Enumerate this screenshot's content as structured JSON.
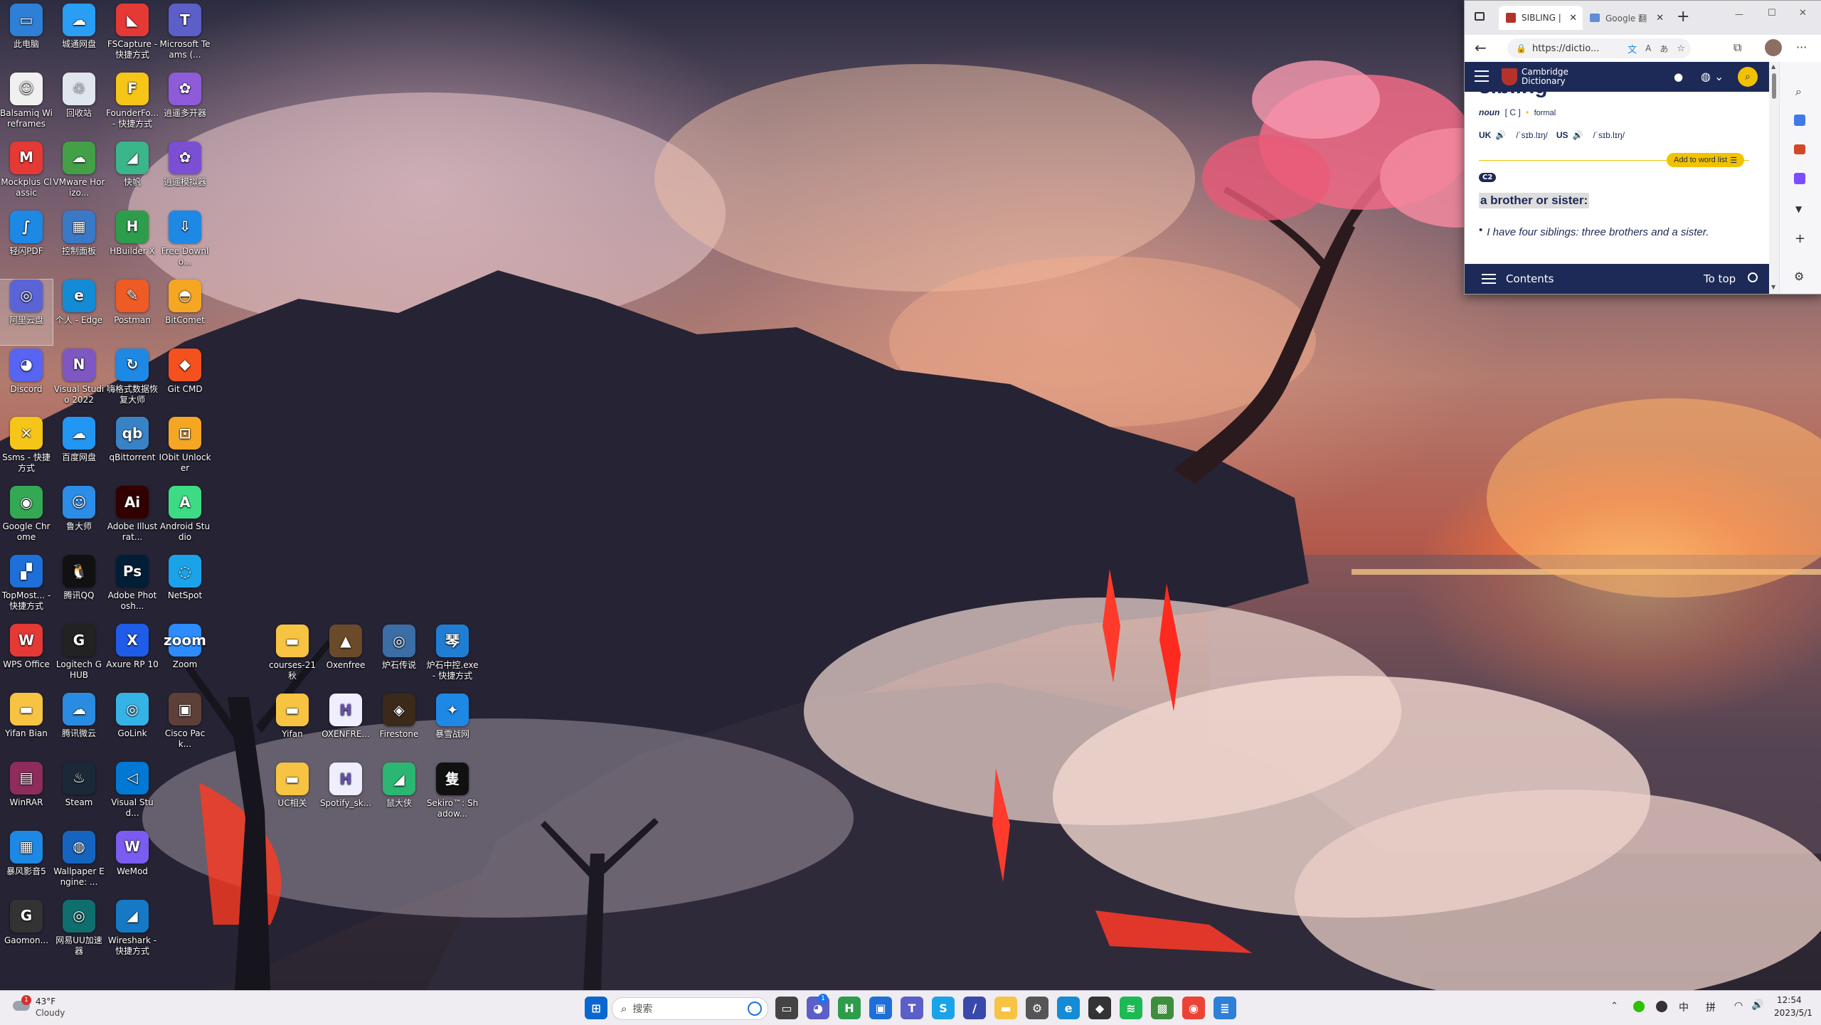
{
  "desktop": {
    "icons": [
      {
        "label": "此电脑",
        "color": "#2e7fd6",
        "glyph": "▭"
      },
      {
        "label": "城通网盘",
        "color": "#2a9df4",
        "glyph": "☁"
      },
      {
        "label": "FSCapture - 快捷方式",
        "color": "#e53935",
        "glyph": "◣"
      },
      {
        "label": "Microsoft Teams (...",
        "color": "#5b5fc7",
        "glyph": "T"
      },
      {
        "label": "Balsamiq Wireframes",
        "color": "#f0f0f0",
        "glyph": "☺"
      },
      {
        "label": "回收站",
        "color": "#dfe6ee",
        "glyph": "♲"
      },
      {
        "label": "FounderFo... - 快捷方式",
        "color": "#f5c518",
        "glyph": "F"
      },
      {
        "label": "逍遥多开器",
        "color": "#8e5cd8",
        "glyph": "✿"
      },
      {
        "label": "Mockplus Classic",
        "color": "#e53935",
        "glyph": "M"
      },
      {
        "label": "VMware Horizo...",
        "color": "#43a047",
        "glyph": "☁"
      },
      {
        "label": "快帆",
        "color": "#3bb58a",
        "glyph": "◢"
      },
      {
        "label": "逍遥模拟器",
        "color": "#7b4fd3",
        "glyph": "✿"
      },
      {
        "label": "轻闪PDF",
        "color": "#1e88e5",
        "glyph": "∫"
      },
      {
        "label": "控制面板",
        "color": "#3a79c6",
        "glyph": "▦"
      },
      {
        "label": "HBuilder X",
        "color": "#2e9d4b",
        "glyph": "H"
      },
      {
        "label": "Free Downlo...",
        "color": "#1e88e5",
        "glyph": "⇩"
      },
      {
        "label": "阿里云盘",
        "color": "#5b64d6",
        "glyph": "◎"
      },
      {
        "label": "个人 - Edge",
        "color": "#138bd5",
        "glyph": "e"
      },
      {
        "label": "Postman",
        "color": "#ef5b25",
        "glyph": "✎"
      },
      {
        "label": "BitComet",
        "color": "#f5a623",
        "glyph": "◓"
      },
      {
        "label": "Discord",
        "color": "#5865f2",
        "glyph": "◕"
      },
      {
        "label": "Visual Studio 2022",
        "color": "#7e57c2",
        "glyph": "N"
      },
      {
        "label": "嗨格式数据恢复大师",
        "color": "#1e88e5",
        "glyph": "↻"
      },
      {
        "label": "Git CMD",
        "color": "#f4511e",
        "glyph": "◆"
      },
      {
        "label": "Ssms - 快捷方式",
        "color": "#f5c518",
        "glyph": "✕"
      },
      {
        "label": "百度网盘",
        "color": "#2196f3",
        "glyph": "☁"
      },
      {
        "label": "qBittorrent",
        "color": "#3a82c6",
        "glyph": "qb"
      },
      {
        "label": "IObit Unlocker",
        "color": "#f5a623",
        "glyph": "⊡"
      },
      {
        "label": "Google Chrome",
        "color": "#34a853",
        "glyph": "◉"
      },
      {
        "label": "鲁大师",
        "color": "#2b8de8",
        "glyph": "☺"
      },
      {
        "label": "Adobe Illustrat...",
        "color": "#330000",
        "glyph": "Ai"
      },
      {
        "label": "Android Studio",
        "color": "#3ddc84",
        "glyph": "A"
      },
      {
        "label": "TopMost... - 快捷方式",
        "color": "#1e6fd9",
        "glyph": "▞"
      },
      {
        "label": "腾讯QQ",
        "color": "#111111",
        "glyph": "🐧"
      },
      {
        "label": "Adobe Photosh...",
        "color": "#001e36",
        "glyph": "Ps"
      },
      {
        "label": "NetSpot",
        "color": "#1aa3e8",
        "glyph": "◌"
      },
      {
        "label": "WPS Office",
        "color": "#e53935",
        "glyph": "W"
      },
      {
        "label": "Logitech G HUB",
        "color": "#222222",
        "glyph": "G"
      },
      {
        "label": "Axure RP 10",
        "color": "#1f5ce8",
        "glyph": "X"
      },
      {
        "label": "Zoom",
        "color": "#2d8cff",
        "glyph": "zoom"
      },
      {
        "label": "Yifan Bian",
        "color": "#f6c343",
        "glyph": "▬"
      },
      {
        "label": "腾讯微云",
        "color": "#2a8ce0",
        "glyph": "☁"
      },
      {
        "label": "GoLink",
        "color": "#36b3e6",
        "glyph": "◎"
      },
      {
        "label": "Cisco Pack...",
        "color": "#5d4037",
        "glyph": "▣"
      },
      {
        "label": "WinRAR",
        "color": "#8e2c5c",
        "glyph": "▤"
      },
      {
        "label": "Steam",
        "color": "#1b2838",
        "glyph": "♨"
      },
      {
        "label": "Visual Stud...",
        "color": "#0078d4",
        "glyph": "◁"
      },
      {
        "label": "",
        "color": "",
        "glyph": ""
      },
      {
        "label": "暴风影音5",
        "color": "#1e88e5",
        "glyph": "▦"
      },
      {
        "label": "Wallpaper Engine: ...",
        "color": "#1565c0",
        "glyph": "◍"
      },
      {
        "label": "WeMod",
        "color": "#7b5cf0",
        "glyph": "W"
      },
      {
        "label": "",
        "color": "",
        "glyph": ""
      },
      {
        "label": "Gaomon...",
        "color": "#333333",
        "glyph": "G"
      },
      {
        "label": "网易UU加速器",
        "color": "#0f6e6e",
        "glyph": "◎"
      },
      {
        "label": "Wireshark - 快捷方式",
        "color": "#1679c5",
        "glyph": "◢"
      }
    ],
    "mid_icons": [
      {
        "label": "courses-21秋",
        "color": "#f6c343",
        "glyph": "▬"
      },
      {
        "label": "Oxenfree",
        "color": "#6b4a2a",
        "glyph": "▲"
      },
      {
        "label": "炉石传说",
        "color": "#3a6ea5",
        "glyph": "◎"
      },
      {
        "label": "炉石中控.exe - 快捷方式",
        "color": "#1f7ed4",
        "glyph": "琴"
      },
      {
        "label": "Yifan",
        "color": "#f6c343",
        "glyph": "▬"
      },
      {
        "label": "OXENFRE...",
        "color": "#eef",
        "glyph": "H"
      },
      {
        "label": "Firestone",
        "color": "#3b2a1a",
        "glyph": "◈"
      },
      {
        "label": "暴雪战网",
        "color": "#1e88e5",
        "glyph": "✦"
      },
      {
        "label": "UC相关",
        "color": "#f6c343",
        "glyph": "▬"
      },
      {
        "label": "Spotify_sk...",
        "color": "#eef",
        "glyph": "H"
      },
      {
        "label": "鼠大侠",
        "color": "#2bb673",
        "glyph": "◢"
      },
      {
        "label": "Sekiro™: Shadow...",
        "color": "#111",
        "glyph": "隻"
      }
    ]
  },
  "browser": {
    "tabs": [
      {
        "title": "SIBLING |",
        "active": true
      },
      {
        "title": "Google 翻",
        "active": false
      }
    ],
    "new_tab_glyph": "+",
    "window_controls": [
      "—",
      "☐",
      "✕"
    ],
    "url": "https://dictio...",
    "more_glyph": "···",
    "site": {
      "logo_line1": "Cambridge",
      "logo_line2": "Dictionary",
      "headword_partial": "sibling",
      "pos": "noun",
      "grammar": "[ C ]",
      "register": "formal",
      "uk_label": "UK",
      "uk_ipa": "/ˈsɪb.lɪŋ/",
      "us_label": "US",
      "us_ipa": "/ˈsɪb.lɪŋ/",
      "add_to_word_list": "Add to word list",
      "level": "C2",
      "definition": "a brother or sister:",
      "example": "I have four siblings: three brothers and a sister.",
      "footer_contents": "Contents",
      "footer_to_top": "To top"
    }
  },
  "taskbar": {
    "weather_temp": "43°F",
    "weather_desc": "Cloudy",
    "weather_badge": "1",
    "search_placeholder": "搜索",
    "chat_badge": "1",
    "ime_lang": "中",
    "ime_mode": "拼",
    "time": "12:54",
    "date": "2023/5/1",
    "apps": [
      {
        "name": "start",
        "color": "#0a67d0",
        "glyph": "⊞"
      },
      {
        "name": "task-view",
        "color": "#444",
        "glyph": "▭"
      },
      {
        "name": "chat",
        "color": "#5b5fc7",
        "glyph": "◕"
      },
      {
        "name": "hbuilder",
        "color": "#2e9d4b",
        "glyph": "H"
      },
      {
        "name": "store",
        "color": "#1e6fd9",
        "glyph": "▣"
      },
      {
        "name": "teams",
        "color": "#5b5fc7",
        "glyph": "T"
      },
      {
        "name": "app-blue",
        "color": "#1aa3e8",
        "glyph": "S"
      },
      {
        "name": "app-pen",
        "color": "#3949ab",
        "glyph": "/"
      },
      {
        "name": "file-explorer",
        "color": "#f6c343",
        "glyph": "▬"
      },
      {
        "name": "settings",
        "color": "#555",
        "glyph": "⚙"
      },
      {
        "name": "edge",
        "color": "#138bd5",
        "glyph": "e"
      },
      {
        "name": "unity",
        "color": "#333",
        "glyph": "◆"
      },
      {
        "name": "spotify",
        "color": "#1db954",
        "glyph": "≋"
      },
      {
        "name": "minecraft",
        "color": "#3e8e3e",
        "glyph": "▩"
      },
      {
        "name": "chrome",
        "color": "#ea4335",
        "glyph": "◉"
      },
      {
        "name": "notepad",
        "color": "#2e7fd6",
        "glyph": "≣"
      }
    ]
  }
}
